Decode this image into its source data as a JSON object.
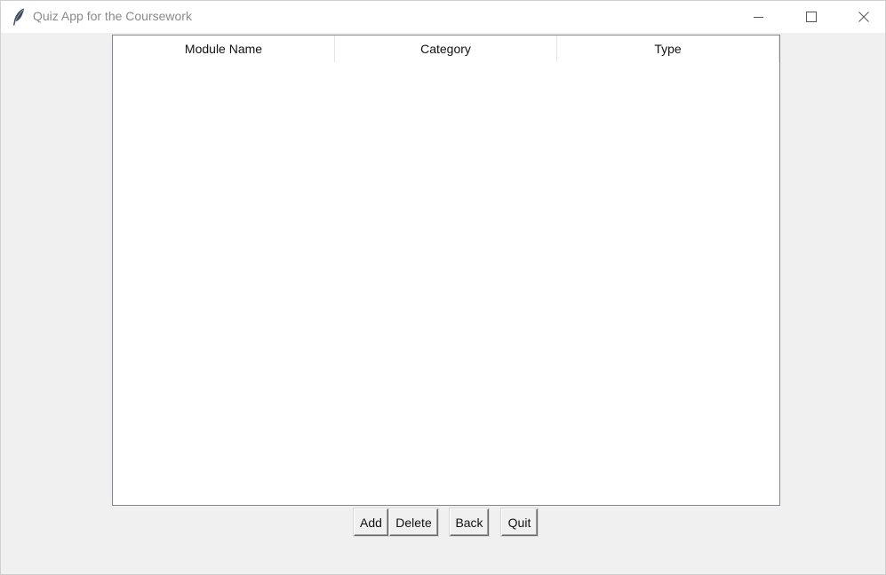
{
  "window": {
    "title": "Quiz App for the Coursework",
    "icon": "feather-icon",
    "controls": [
      "minimize-icon",
      "maximize-icon",
      "close-icon"
    ]
  },
  "table": {
    "columns": [
      "Module Name",
      "Category",
      "Type"
    ],
    "rows": []
  },
  "actions": {
    "add_label": "Add",
    "delete_label": "Delete",
    "back_label": "Back",
    "quit_label": "Quit"
  }
}
